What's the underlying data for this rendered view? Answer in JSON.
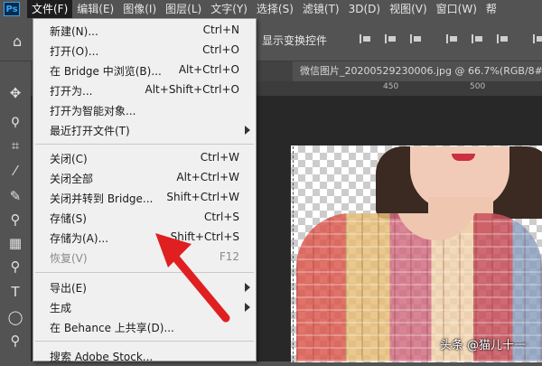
{
  "app": {
    "logo_text": "Ps"
  },
  "menubar": {
    "items": [
      "文件(F)",
      "编辑(E)",
      "图像(I)",
      "图层(L)",
      "文字(Y)",
      "选择(S)",
      "滤镜(T)",
      "3D(D)",
      "视图(V)",
      "窗口(W)",
      "帮"
    ]
  },
  "options_bar": {
    "show_transform_controls": "显示变换控件"
  },
  "document": {
    "tab_title": "微信图片_20200529230006.jpg @ 66.7%(RGB/8#)"
  },
  "ruler": {
    "labels": [
      "450",
      "500"
    ]
  },
  "file_menu": {
    "items": [
      {
        "label": "新建(N)...",
        "shortcut": "Ctrl+N"
      },
      {
        "label": "打开(O)...",
        "shortcut": "Ctrl+O"
      },
      {
        "label": "在 Bridge 中浏览(B)...",
        "shortcut": "Alt+Ctrl+O"
      },
      {
        "label": "打开为...",
        "shortcut": "Alt+Shift+Ctrl+O"
      },
      {
        "label": "打开为智能对象...",
        "shortcut": ""
      },
      {
        "label": "最近打开文件(T)",
        "shortcut": "",
        "submenu": true
      },
      {
        "label": "关闭(C)",
        "shortcut": "Ctrl+W"
      },
      {
        "label": "关闭全部",
        "shortcut": "Alt+Ctrl+W"
      },
      {
        "label": "关闭并转到 Bridge...",
        "shortcut": "Shift+Ctrl+W"
      },
      {
        "label": "存储(S)",
        "shortcut": "Ctrl+S"
      },
      {
        "label": "存储为(A)...",
        "shortcut": "Shift+Ctrl+S"
      },
      {
        "label": "恢复(V)",
        "shortcut": "F12",
        "disabled": true
      },
      {
        "label": "导出(E)",
        "shortcut": "",
        "submenu": true
      },
      {
        "label": "生成",
        "shortcut": "",
        "submenu": true
      },
      {
        "label": "在 Behance 上共享(D)...",
        "shortcut": ""
      },
      {
        "label": "搜索 Adobe Stock...",
        "shortcut": ""
      }
    ]
  },
  "watermark": "头条 @猫儿十一",
  "colors": {
    "annotation_arrow": "#e02020",
    "menu_bg": "#f0f0f0",
    "ui_bg": "#535353"
  },
  "tools": [
    "move-icon",
    "lasso-icon",
    "crop-icon",
    "eyedropper-icon",
    "brush-icon",
    "clone-stamp-icon",
    "gradient-icon",
    "dodge-icon",
    "type-icon",
    "ellipse-icon",
    "zoom-icon"
  ]
}
